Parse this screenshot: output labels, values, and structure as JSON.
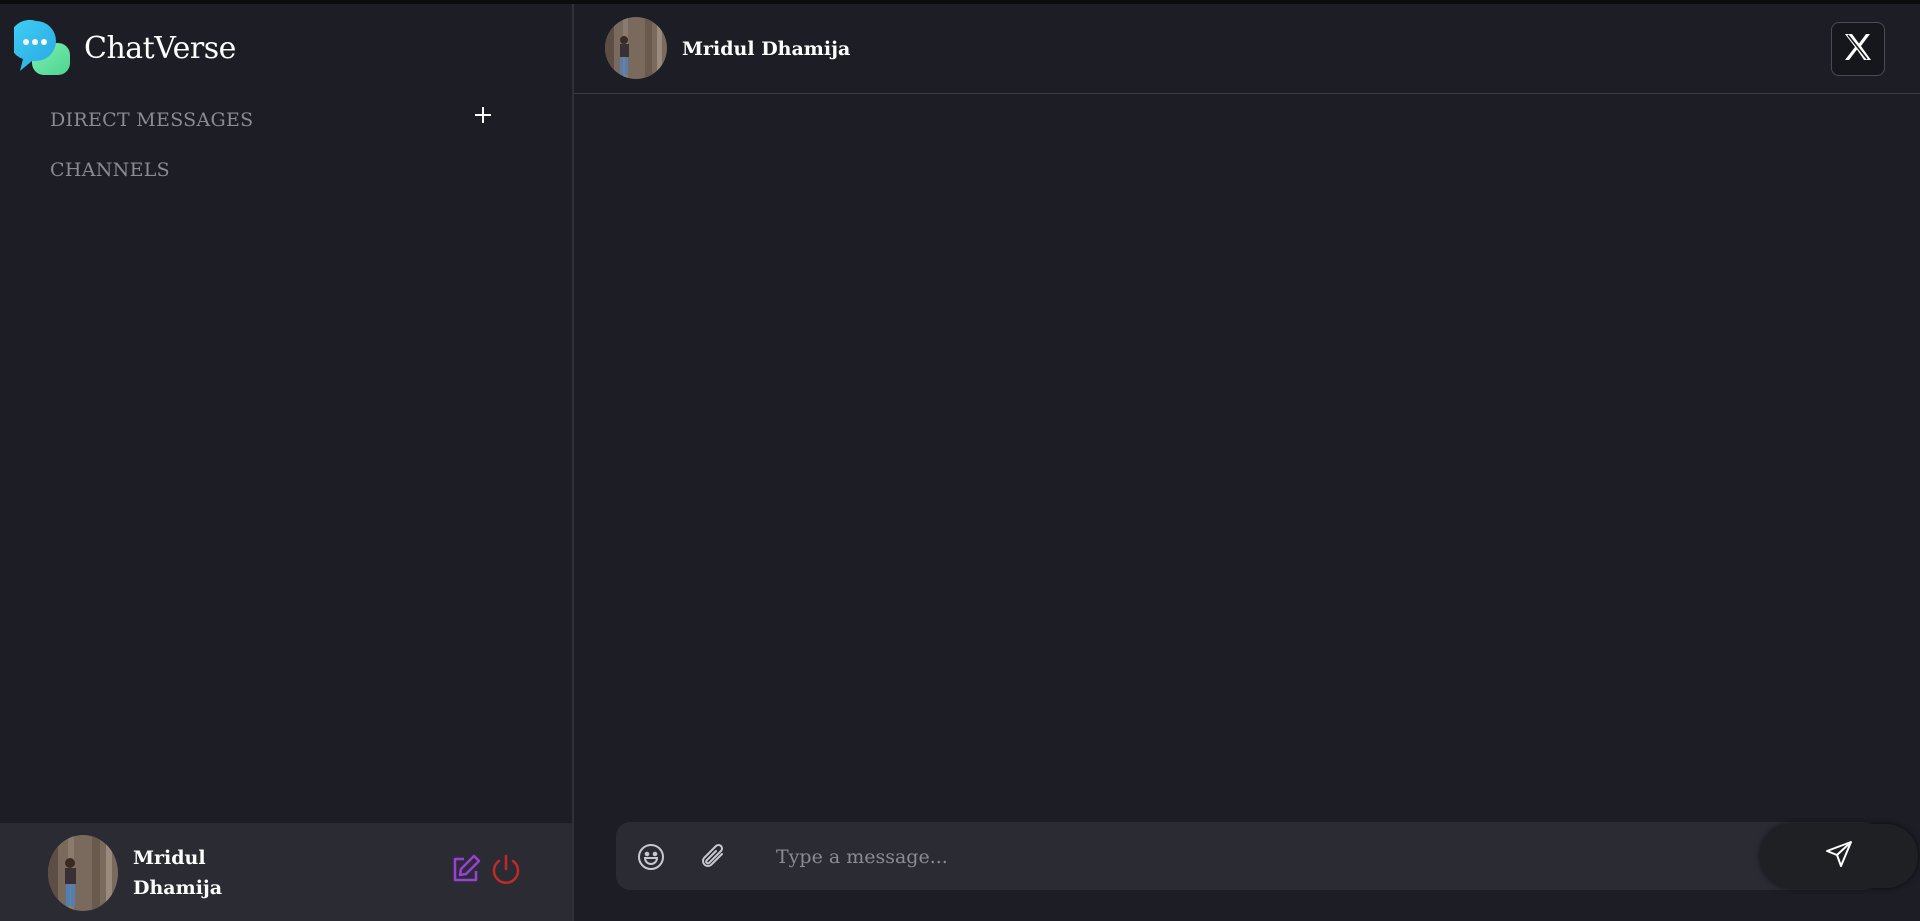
{
  "app": {
    "name": "ChatVerse",
    "colors": {
      "background": "#1c1d25",
      "panel": "#2a2b33",
      "accent_edit": "#9b3fd6",
      "accent_logout": "#c22a2a",
      "logo_blue": "#35c3ee",
      "logo_green": "#5ee6a3"
    }
  },
  "sidebar": {
    "direct_messages_label": "DIRECT MESSAGES",
    "channels_label": "CHANNELS",
    "add_icon": "plus-icon"
  },
  "profile": {
    "first_name": "Mridul",
    "last_name": "Dhamija",
    "edit_icon": "edit-icon",
    "logout_icon": "power-icon"
  },
  "chat": {
    "contact_name": "Mridul Dhamija",
    "close_icon": "close-icon",
    "composer": {
      "placeholder": "Type a message...",
      "emoji_icon": "emoji-icon",
      "attach_icon": "paperclip-icon",
      "send_icon": "send-icon"
    }
  }
}
